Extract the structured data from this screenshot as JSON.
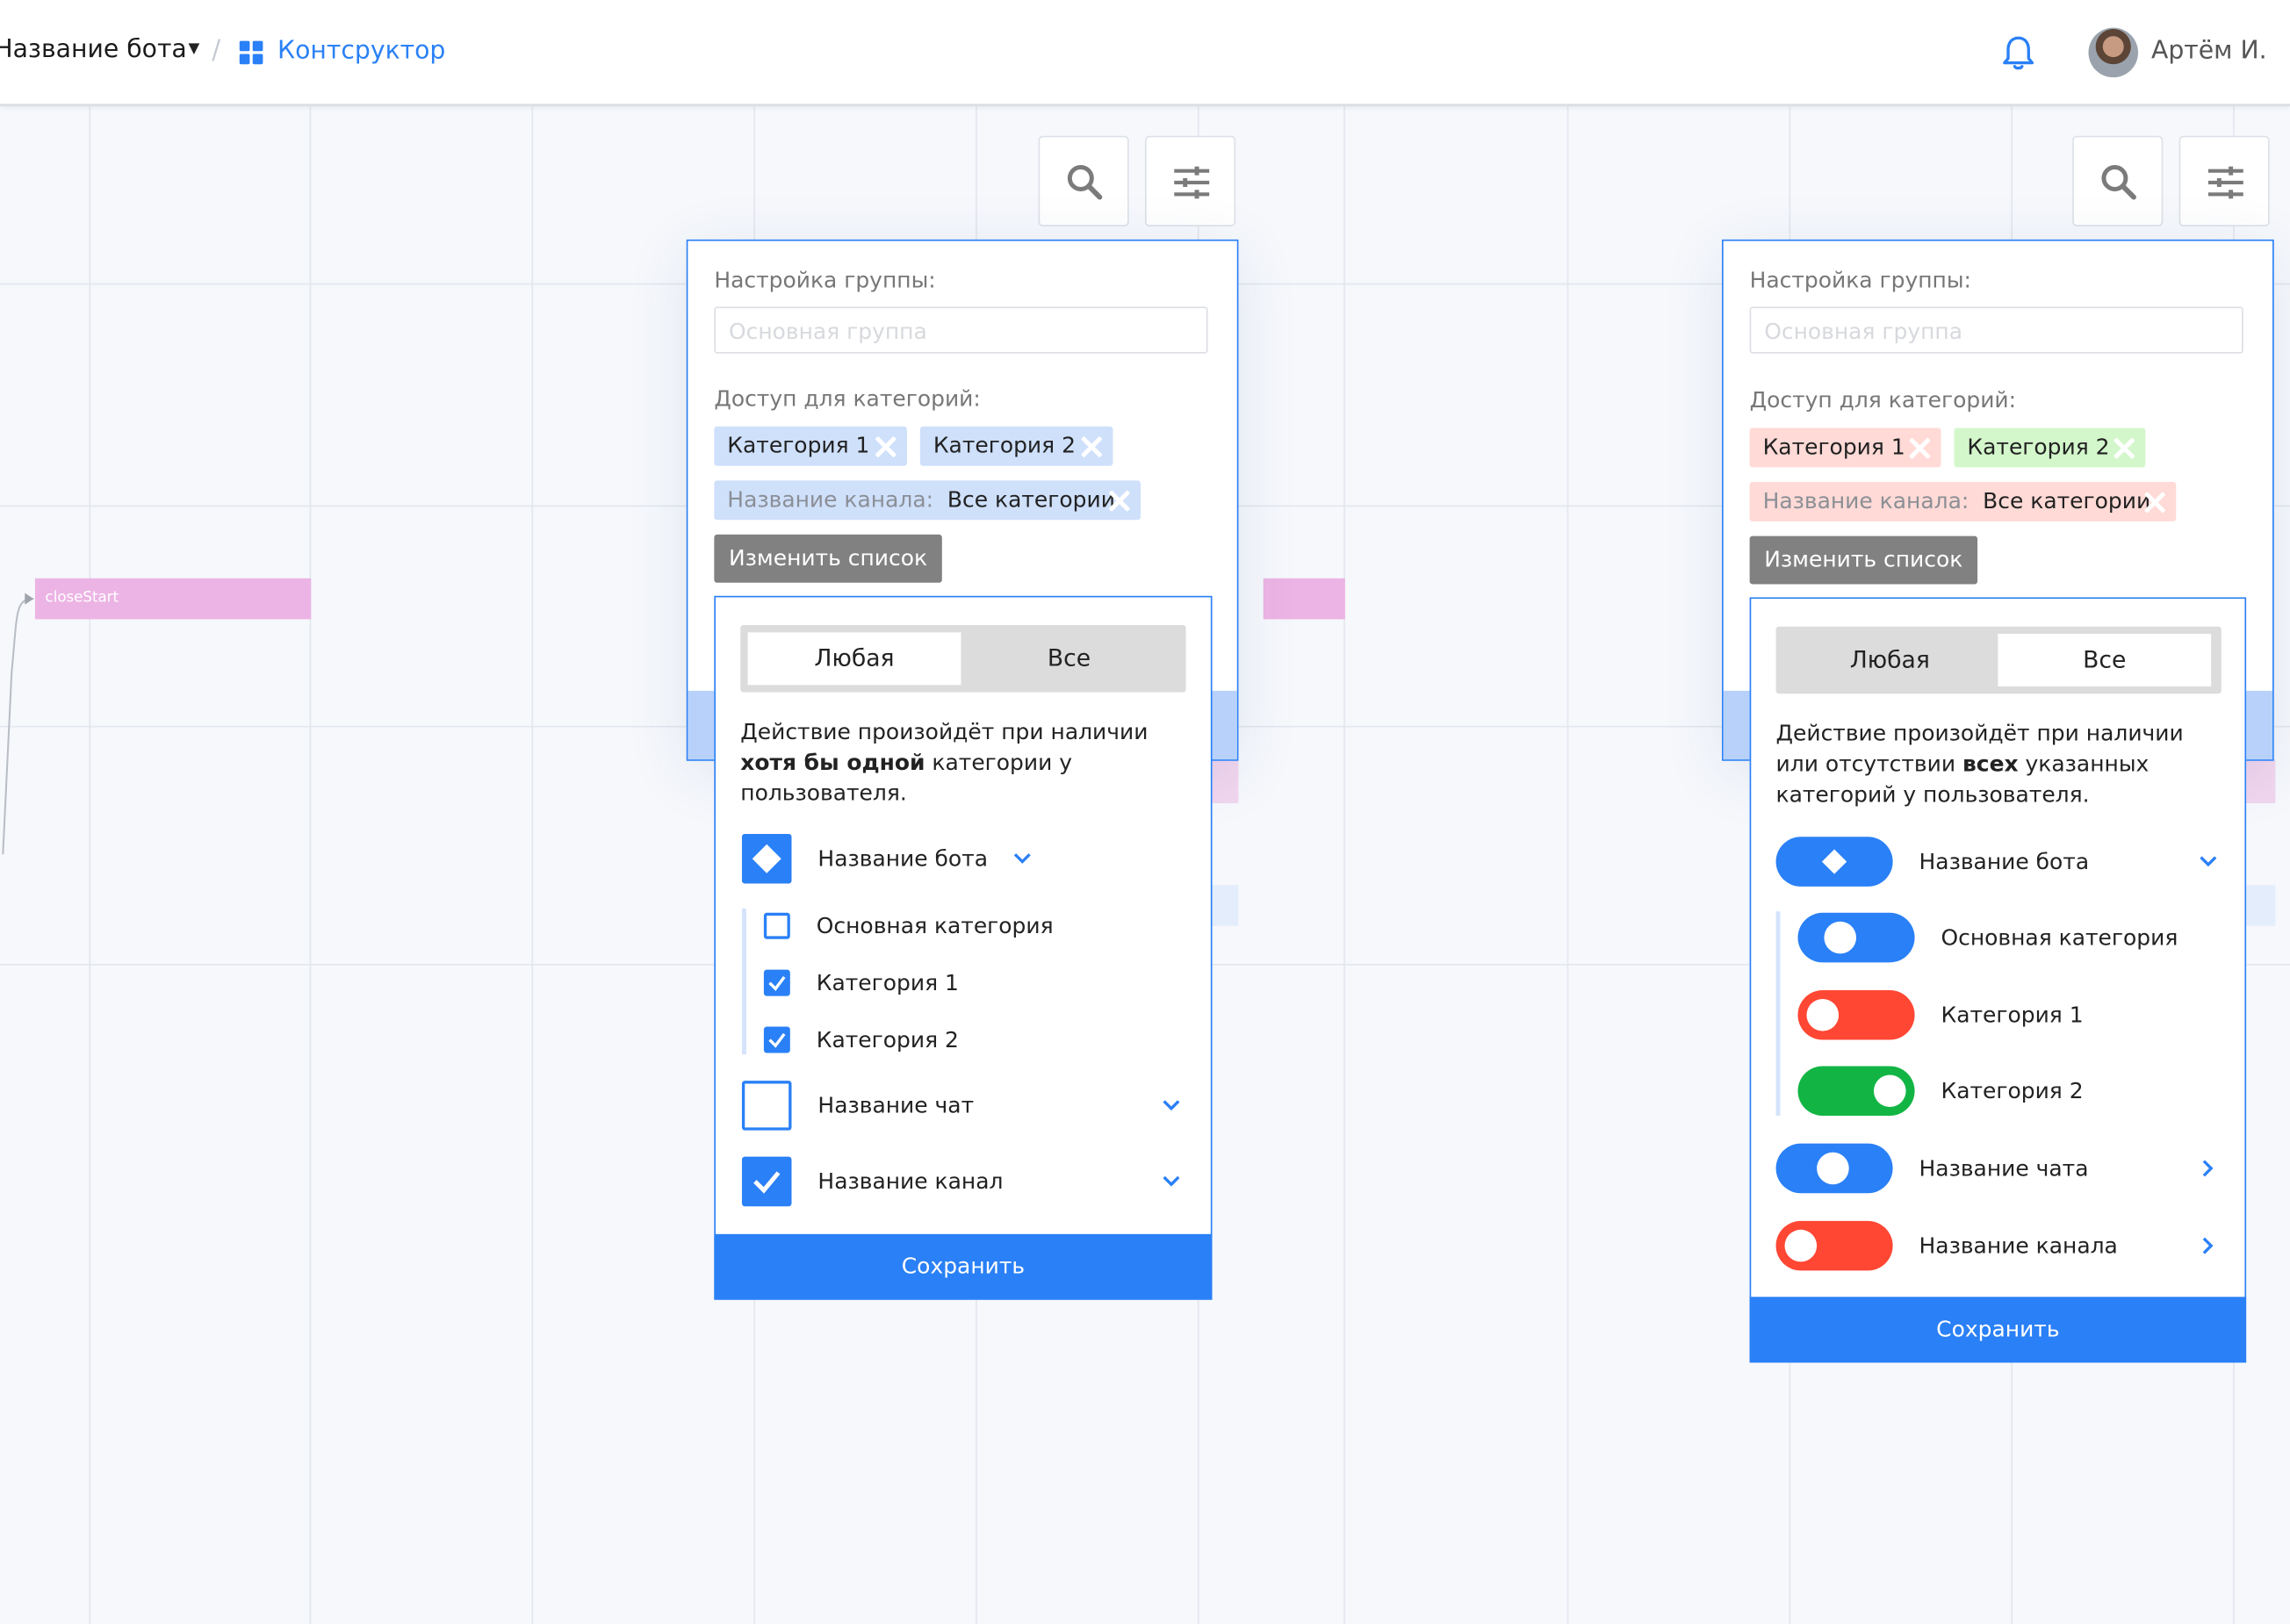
{
  "header": {
    "bot_name": "Название бота",
    "separator": "/",
    "constructor_label": "Контсруктор",
    "user_name": "Артём И."
  },
  "canvas": {
    "node_label": "closeStart"
  },
  "panels": [
    {
      "title": "Настройка группы:",
      "group_placeholder": "Основная группа",
      "access_label": "Доступ для категорий:",
      "chips": [
        "Категория 1",
        "Категория 2"
      ],
      "channel_chip_label": "Название канала:",
      "channel_chip_value": "Все категории",
      "change_list_button": "Изменить список",
      "segment_options": [
        "Любая",
        "Все"
      ],
      "active_segment": "Любая",
      "description_before": "Действие произойдёт при наличии ",
      "description_bold": "хотя бы одной",
      "description_after": " категории у пользователя.",
      "items": [
        {
          "label": "Название бота",
          "state": "partial",
          "expanded": true
        },
        {
          "label": "Основная категория",
          "checked": false
        },
        {
          "label": "Категория 1",
          "checked": true
        },
        {
          "label": "Категория 2",
          "checked": true
        },
        {
          "label": "Название чат",
          "state": "unchecked",
          "expanded": false
        },
        {
          "label": "Название канал",
          "state": "checked",
          "expanded": false
        }
      ],
      "save_button": "Сохранить"
    },
    {
      "title": "Настройка группы:",
      "group_placeholder": "Основная группа",
      "access_label": "Доступ для категорий:",
      "chips": [
        "Категория 1",
        "Категория 2"
      ],
      "channel_chip_label": "Название канала:",
      "channel_chip_value": "Все категории",
      "change_list_button": "Изменить список",
      "segment_options": [
        "Любая",
        "Все"
      ],
      "active_segment": "Все",
      "description_before": "Действие произойдёт при наличии или отсутствии ",
      "description_bold": "всех",
      "description_after": " указанных категорий у пользователя.",
      "items": [
        {
          "label": "Название бота",
          "state": "partial",
          "color": "#2a80f6"
        },
        {
          "label": "Основная категория",
          "state": "include",
          "color": "#2a80f6"
        },
        {
          "label": "Категория 1",
          "state": "exclude",
          "color": "#ff4734"
        },
        {
          "label": "Категория 2",
          "state": "require",
          "color": "#12b544"
        },
        {
          "label": "Название чата",
          "state": "include",
          "color": "#2a80f6"
        },
        {
          "label": "Название канала",
          "state": "exclude",
          "color": "#ff4734"
        }
      ],
      "save_button": "Сохранить"
    }
  ],
  "colors": {
    "accent": "#2a80f6",
    "red": "#ff4734",
    "green": "#12b544",
    "chip_blue": "#cfe0fb",
    "chip_red": "#ffdad6",
    "chip_green": "#d3f7cb"
  }
}
